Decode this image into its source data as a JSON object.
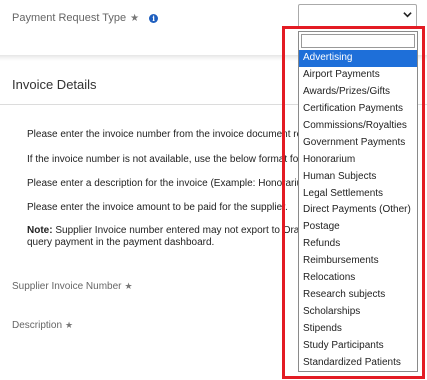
{
  "header": {
    "payment_request_type_label": "Payment Request Type",
    "required_icon": "star-icon",
    "info_icon_glyph": "i"
  },
  "select": {
    "value": "",
    "chevron": "⌄"
  },
  "invoice_section": {
    "title": "Invoice Details",
    "instructions": [
      "Please enter the invoice number from the invoice document rec",
      "If the invoice number is not available, use the below format fo",
      "Please enter a description for the invoice (Example: Honorarium",
      "Please enter the invoice amount to be paid for the supplier."
    ],
    "note_label": "Note:",
    "note_text": " Supplier Invoice number entered may not export to Oracl",
    "note_line2": "query payment in the payment dashboard."
  },
  "fields": {
    "supplier_invoice_number_label": "Supplier Invoice Number",
    "description_label": "Description"
  },
  "dropdown": {
    "search_value": "",
    "selected_index": 0,
    "options": [
      "Advertising",
      "Airport Payments",
      "Awards/Prizes/Gifts",
      "Certification Payments",
      "Commissions/Royalties",
      "Government Payments",
      "Honorarium",
      "Human Subjects",
      "Legal Settlements",
      "Direct Payments (Other)",
      "Postage",
      "Refunds",
      "Reimbursements",
      "Relocations",
      "Research subjects",
      "Scholarships",
      "Stipends",
      "Study Participants",
      "Standardized Patients"
    ]
  },
  "colors": {
    "highlight_border": "#e31b23",
    "selected_option_bg": "#1e6fd9",
    "info_icon_bg": "#1f5fbf"
  }
}
